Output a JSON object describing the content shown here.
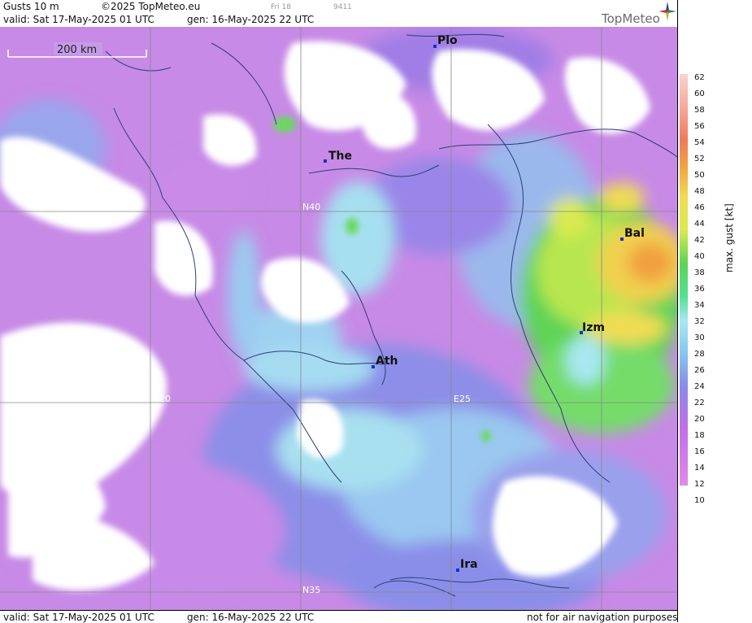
{
  "header": {
    "product": "Gusts 10 m",
    "copyright": "©2025 TopMeteo.eu",
    "small_day": "Fri 18",
    "small_code": "9411",
    "valid": "valid:  Sat  17-May-2025  01 UTC",
    "gen": "gen: 16-May-2025 22 UTC",
    "logo": "TopMeteo"
  },
  "scale_bar": {
    "label": "200 km"
  },
  "grid_labels": {
    "n40": "N40",
    "n35": "N35",
    "e20": "E20",
    "e25": "E25"
  },
  "cities": [
    {
      "name": "Plo"
    },
    {
      "name": "The"
    },
    {
      "name": "Bal"
    },
    {
      "name": "Izm"
    },
    {
      "name": "Ath"
    },
    {
      "name": "Ira"
    }
  ],
  "footer": {
    "valid": "valid:  Sat  17-May-2025  01 UTC",
    "gen": "gen: 16-May-2025 22 UTC",
    "notice": "not for air navigation purposes"
  },
  "legend": {
    "unit": "max. gust  [kt]",
    "ticks": [
      "62",
      "60",
      "58",
      "56",
      "54",
      "52",
      "50",
      "48",
      "46",
      "44",
      "42",
      "40",
      "38",
      "36",
      "34",
      "32",
      "30",
      "28",
      "26",
      "24",
      "22",
      "20",
      "18",
      "16",
      "14",
      "12",
      "10"
    ],
    "colors": [
      "#f9d4d0",
      "#f7c3bc",
      "#f5aa9c",
      "#f48f7a",
      "#f07a5c",
      "#ed7a45",
      "#f0a040",
      "#f2c04c",
      "#f0dc54",
      "#d9ea4f",
      "#9be04f",
      "#5dd456",
      "#54e090",
      "#8ff0e0",
      "#a8e8f2",
      "#86c6ee",
      "#7aa2e8",
      "#8a8aea",
      "#a77ae8",
      "#c070e6",
      "#d476e4",
      "#e28ae6"
    ],
    "color_notes": "gradient bar colors from 62 kt (top) to 12 kt (bottom)"
  }
}
